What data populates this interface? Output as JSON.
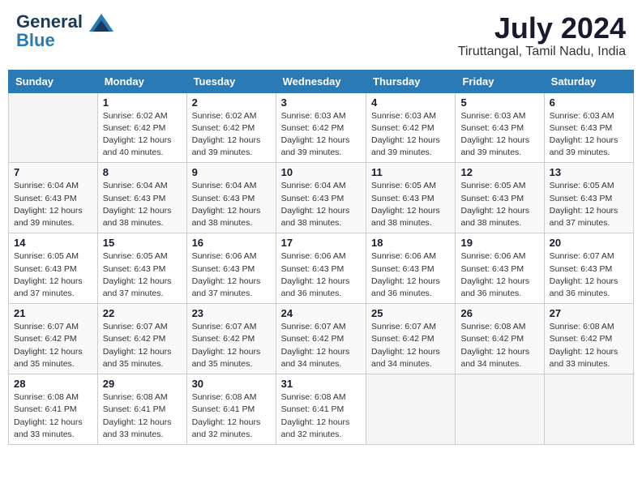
{
  "header": {
    "logo_line1": "General",
    "logo_line2": "Blue",
    "month_title": "July 2024",
    "location": "Tiruttangal, Tamil Nadu, India"
  },
  "weekdays": [
    "Sunday",
    "Monday",
    "Tuesday",
    "Wednesday",
    "Thursday",
    "Friday",
    "Saturday"
  ],
  "weeks": [
    [
      {
        "day": "",
        "sunrise": "",
        "sunset": "",
        "daylight": ""
      },
      {
        "day": "1",
        "sunrise": "Sunrise: 6:02 AM",
        "sunset": "Sunset: 6:42 PM",
        "daylight": "Daylight: 12 hours and 40 minutes."
      },
      {
        "day": "2",
        "sunrise": "Sunrise: 6:02 AM",
        "sunset": "Sunset: 6:42 PM",
        "daylight": "Daylight: 12 hours and 39 minutes."
      },
      {
        "day": "3",
        "sunrise": "Sunrise: 6:03 AM",
        "sunset": "Sunset: 6:42 PM",
        "daylight": "Daylight: 12 hours and 39 minutes."
      },
      {
        "day": "4",
        "sunrise": "Sunrise: 6:03 AM",
        "sunset": "Sunset: 6:42 PM",
        "daylight": "Daylight: 12 hours and 39 minutes."
      },
      {
        "day": "5",
        "sunrise": "Sunrise: 6:03 AM",
        "sunset": "Sunset: 6:43 PM",
        "daylight": "Daylight: 12 hours and 39 minutes."
      },
      {
        "day": "6",
        "sunrise": "Sunrise: 6:03 AM",
        "sunset": "Sunset: 6:43 PM",
        "daylight": "Daylight: 12 hours and 39 minutes."
      }
    ],
    [
      {
        "day": "7",
        "sunrise": "Sunrise: 6:04 AM",
        "sunset": "Sunset: 6:43 PM",
        "daylight": "Daylight: 12 hours and 39 minutes."
      },
      {
        "day": "8",
        "sunrise": "Sunrise: 6:04 AM",
        "sunset": "Sunset: 6:43 PM",
        "daylight": "Daylight: 12 hours and 38 minutes."
      },
      {
        "day": "9",
        "sunrise": "Sunrise: 6:04 AM",
        "sunset": "Sunset: 6:43 PM",
        "daylight": "Daylight: 12 hours and 38 minutes."
      },
      {
        "day": "10",
        "sunrise": "Sunrise: 6:04 AM",
        "sunset": "Sunset: 6:43 PM",
        "daylight": "Daylight: 12 hours and 38 minutes."
      },
      {
        "day": "11",
        "sunrise": "Sunrise: 6:05 AM",
        "sunset": "Sunset: 6:43 PM",
        "daylight": "Daylight: 12 hours and 38 minutes."
      },
      {
        "day": "12",
        "sunrise": "Sunrise: 6:05 AM",
        "sunset": "Sunset: 6:43 PM",
        "daylight": "Daylight: 12 hours and 38 minutes."
      },
      {
        "day": "13",
        "sunrise": "Sunrise: 6:05 AM",
        "sunset": "Sunset: 6:43 PM",
        "daylight": "Daylight: 12 hours and 37 minutes."
      }
    ],
    [
      {
        "day": "14",
        "sunrise": "Sunrise: 6:05 AM",
        "sunset": "Sunset: 6:43 PM",
        "daylight": "Daylight: 12 hours and 37 minutes."
      },
      {
        "day": "15",
        "sunrise": "Sunrise: 6:05 AM",
        "sunset": "Sunset: 6:43 PM",
        "daylight": "Daylight: 12 hours and 37 minutes."
      },
      {
        "day": "16",
        "sunrise": "Sunrise: 6:06 AM",
        "sunset": "Sunset: 6:43 PM",
        "daylight": "Daylight: 12 hours and 37 minutes."
      },
      {
        "day": "17",
        "sunrise": "Sunrise: 6:06 AM",
        "sunset": "Sunset: 6:43 PM",
        "daylight": "Daylight: 12 hours and 36 minutes."
      },
      {
        "day": "18",
        "sunrise": "Sunrise: 6:06 AM",
        "sunset": "Sunset: 6:43 PM",
        "daylight": "Daylight: 12 hours and 36 minutes."
      },
      {
        "day": "19",
        "sunrise": "Sunrise: 6:06 AM",
        "sunset": "Sunset: 6:43 PM",
        "daylight": "Daylight: 12 hours and 36 minutes."
      },
      {
        "day": "20",
        "sunrise": "Sunrise: 6:07 AM",
        "sunset": "Sunset: 6:43 PM",
        "daylight": "Daylight: 12 hours and 36 minutes."
      }
    ],
    [
      {
        "day": "21",
        "sunrise": "Sunrise: 6:07 AM",
        "sunset": "Sunset: 6:42 PM",
        "daylight": "Daylight: 12 hours and 35 minutes."
      },
      {
        "day": "22",
        "sunrise": "Sunrise: 6:07 AM",
        "sunset": "Sunset: 6:42 PM",
        "daylight": "Daylight: 12 hours and 35 minutes."
      },
      {
        "day": "23",
        "sunrise": "Sunrise: 6:07 AM",
        "sunset": "Sunset: 6:42 PM",
        "daylight": "Daylight: 12 hours and 35 minutes."
      },
      {
        "day": "24",
        "sunrise": "Sunrise: 6:07 AM",
        "sunset": "Sunset: 6:42 PM",
        "daylight": "Daylight: 12 hours and 34 minutes."
      },
      {
        "day": "25",
        "sunrise": "Sunrise: 6:07 AM",
        "sunset": "Sunset: 6:42 PM",
        "daylight": "Daylight: 12 hours and 34 minutes."
      },
      {
        "day": "26",
        "sunrise": "Sunrise: 6:08 AM",
        "sunset": "Sunset: 6:42 PM",
        "daylight": "Daylight: 12 hours and 34 minutes."
      },
      {
        "day": "27",
        "sunrise": "Sunrise: 6:08 AM",
        "sunset": "Sunset: 6:42 PM",
        "daylight": "Daylight: 12 hours and 33 minutes."
      }
    ],
    [
      {
        "day": "28",
        "sunrise": "Sunrise: 6:08 AM",
        "sunset": "Sunset: 6:41 PM",
        "daylight": "Daylight: 12 hours and 33 minutes."
      },
      {
        "day": "29",
        "sunrise": "Sunrise: 6:08 AM",
        "sunset": "Sunset: 6:41 PM",
        "daylight": "Daylight: 12 hours and 33 minutes."
      },
      {
        "day": "30",
        "sunrise": "Sunrise: 6:08 AM",
        "sunset": "Sunset: 6:41 PM",
        "daylight": "Daylight: 12 hours and 32 minutes."
      },
      {
        "day": "31",
        "sunrise": "Sunrise: 6:08 AM",
        "sunset": "Sunset: 6:41 PM",
        "daylight": "Daylight: 12 hours and 32 minutes."
      },
      {
        "day": "",
        "sunrise": "",
        "sunset": "",
        "daylight": ""
      },
      {
        "day": "",
        "sunrise": "",
        "sunset": "",
        "daylight": ""
      },
      {
        "day": "",
        "sunrise": "",
        "sunset": "",
        "daylight": ""
      }
    ]
  ]
}
